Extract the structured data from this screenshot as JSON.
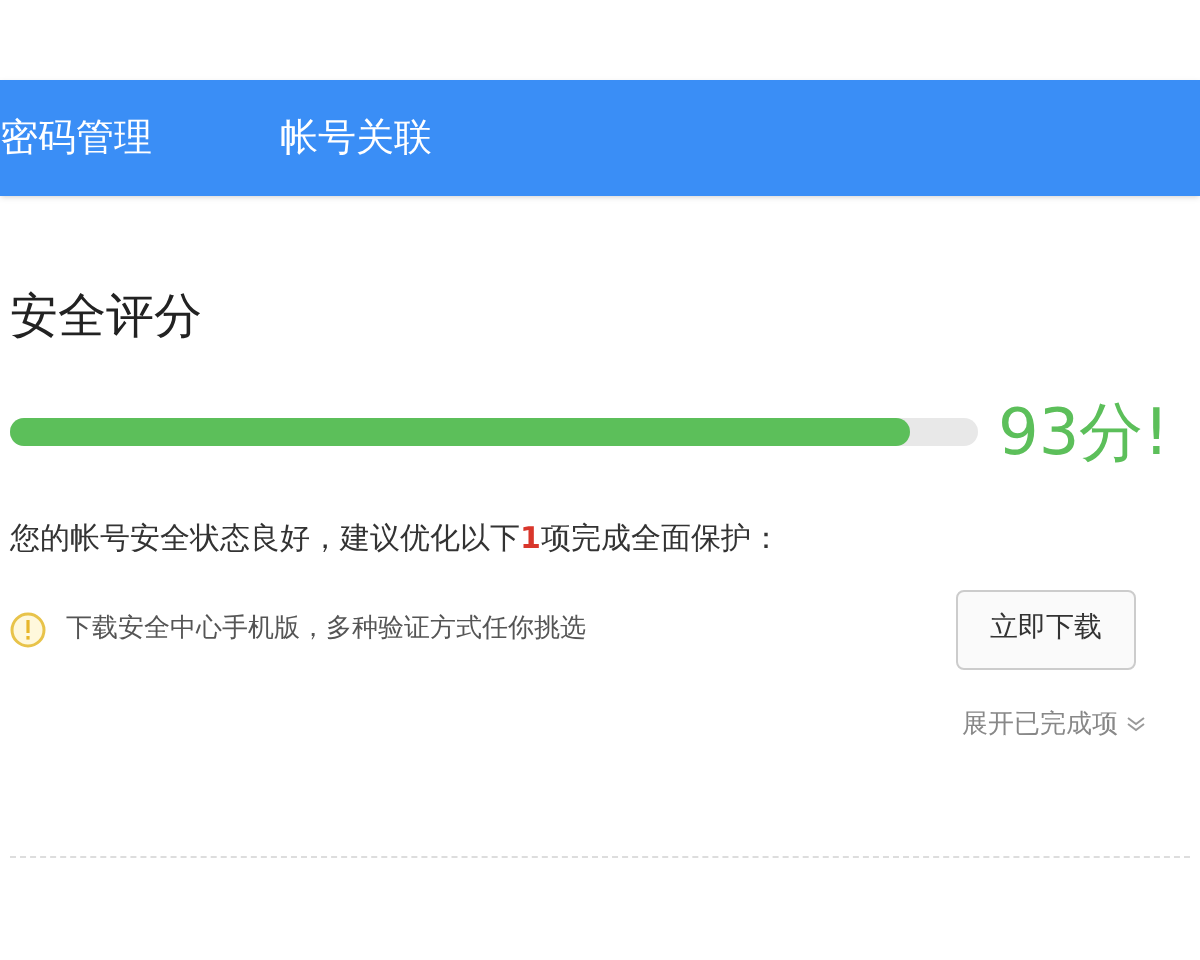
{
  "tabs": [
    {
      "label": "密码管理"
    },
    {
      "label": "帐号关联"
    }
  ],
  "score": {
    "title": "安全评分",
    "level": 0.93,
    "reading": "93分!"
  },
  "summary": {
    "prefix": "您的帐号安全状态良好，建议优化以下",
    "count": "1",
    "suffix": "项完成全面保护："
  },
  "tasks": [
    {
      "kind": "warning",
      "text": "下载安全中心手机版，多种验证方式任你挑选",
      "button": "立即下载"
    }
  ],
  "expand_link": "展开已完成项"
}
